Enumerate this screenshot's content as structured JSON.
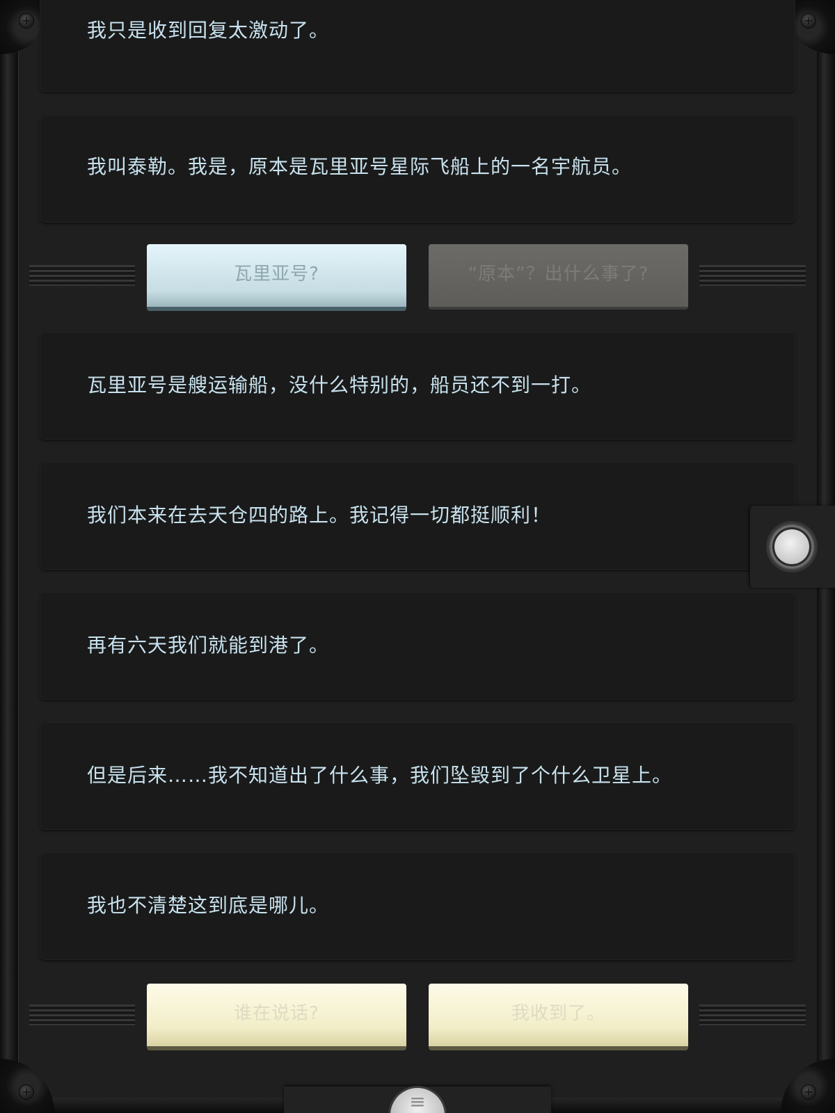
{
  "conversation": {
    "messages": [
      "我只是收到回复太激动了。",
      "我叫泰勒。我是，原本是瓦里亚号星际飞船上的一名宇航员。",
      "瓦里亚号是艘运输船，没什么特别的，船员还不到一打。",
      "我们本来在去天仓四的路上。我记得一切都挺顺利！",
      "再有六天我们就能到港了。",
      "但是后来……我不知道出了什么事，我们坠毁到了个什么卫星上。",
      "我也不清楚这到底是哪儿。"
    ]
  },
  "choices_middle": {
    "selected_label": "瓦里亚号?",
    "other_label": "“原本”？出什么事了?"
  },
  "choices_bottom": {
    "left_label": "谁在说话?",
    "right_label": "我收到了。"
  },
  "icons": {
    "side_button": "circle-toggle-icon",
    "menu_button": "hamburger-menu-icon",
    "corner_screws": "screw-icon"
  },
  "colors": {
    "message_text": "#c8e2ee",
    "selected_choice": "#d6ecf1",
    "disabled_choice": "#5f5e5b",
    "pending_choice": "#f5f1cf",
    "panel_background": "#1a1a1a"
  }
}
